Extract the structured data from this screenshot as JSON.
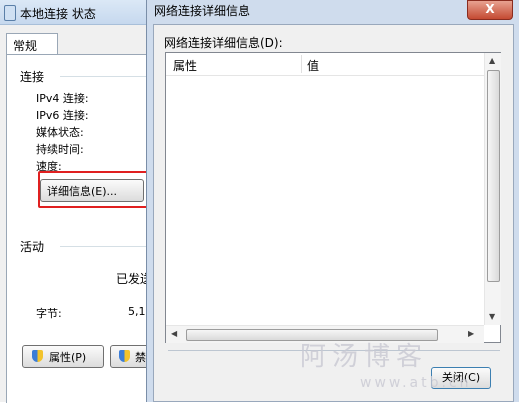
{
  "back_window": {
    "title": "本地连接 状态",
    "tab": "常规",
    "connection_group": "连接",
    "ipv4": "IPv4 连接:",
    "ipv6": "IPv6 连接:",
    "media_state": "媒体状态:",
    "duration": "持续时间:",
    "speed": "速度:",
    "details_button": "详细信息(E)...",
    "activity_group": "活动",
    "sent_label": "已发送",
    "bytes_label": "字节:",
    "bytes_value": "5,1",
    "properties_button": "属性(P)",
    "disable_button": "禁"
  },
  "front_window": {
    "title": "网络连接详细信息",
    "close_x": "X",
    "list_label": "网络连接详细信息(D):",
    "columns": [
      "属性",
      "值"
    ],
    "close_button": "关闭(C)"
  },
  "watermark": {
    "text": "阿汤博客",
    "url": "www.atb.cn"
  },
  "colors": {
    "highlight_box": "#e02020",
    "title_bar": "#cfdced",
    "close_x": "#c44a32"
  }
}
